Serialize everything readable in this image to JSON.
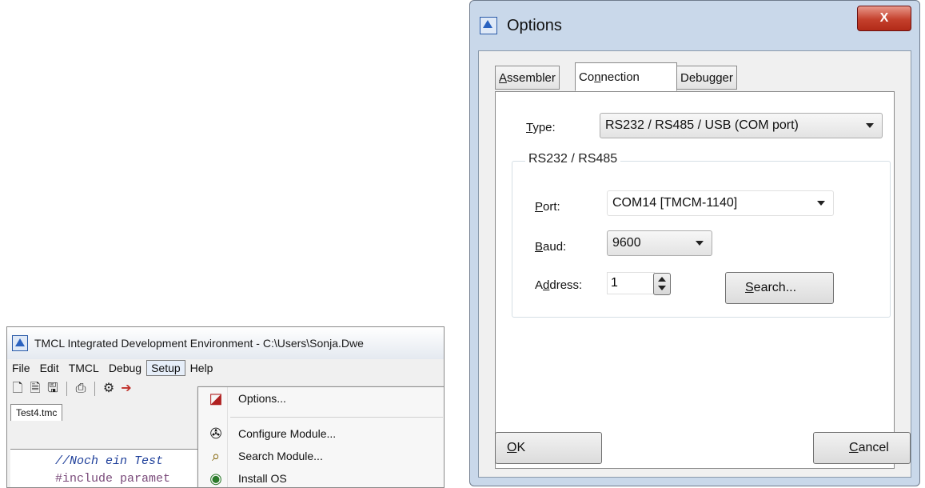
{
  "ide": {
    "title": "TMCL Integrated Development Environment - C:\\Users\\Sonja.Dwe",
    "menu": [
      "File",
      "Edit",
      "TMCL",
      "Debug",
      "Setup",
      "Help"
    ],
    "file_tab": "Test4.tmc",
    "code_lines": [
      "//Noch ein Test",
      "#include paramet"
    ],
    "setup_menu": {
      "items": [
        {
          "label": "Options...",
          "icon": "options-icon"
        },
        {
          "label": "Configure Module...",
          "icon": "configure-module-icon"
        },
        {
          "label": "Search Module...",
          "icon": "search-module-icon"
        },
        {
          "label": "Install OS",
          "icon": "install-os-icon"
        }
      ]
    }
  },
  "dialog": {
    "title": "Options",
    "close_label": "X",
    "tabs": {
      "assembler_a": "A",
      "assembler_rest": "ssembler",
      "connection_a": "Co",
      "connection_b": "n",
      "connection_rest": "nection",
      "debugger": "Debugger"
    },
    "type_label_u": "T",
    "type_label_rest": "ype:",
    "type_value": "RS232 / RS485 / USB (COM port)",
    "group_title": "RS232 / RS485",
    "port_label_u": "P",
    "port_label_rest": "ort:",
    "port_value": "COM14  [TMCM-1140]",
    "baud_label_u": "B",
    "baud_label_rest": "aud:",
    "baud_value": "9600",
    "address_label_a": "A",
    "address_label_u": "d",
    "address_label_rest": "dress:",
    "address_value": "1",
    "search_u": "S",
    "search_rest": "earch...",
    "ok_u": "O",
    "ok_rest": "K",
    "cancel_u": "C",
    "cancel_rest": "ancel"
  }
}
